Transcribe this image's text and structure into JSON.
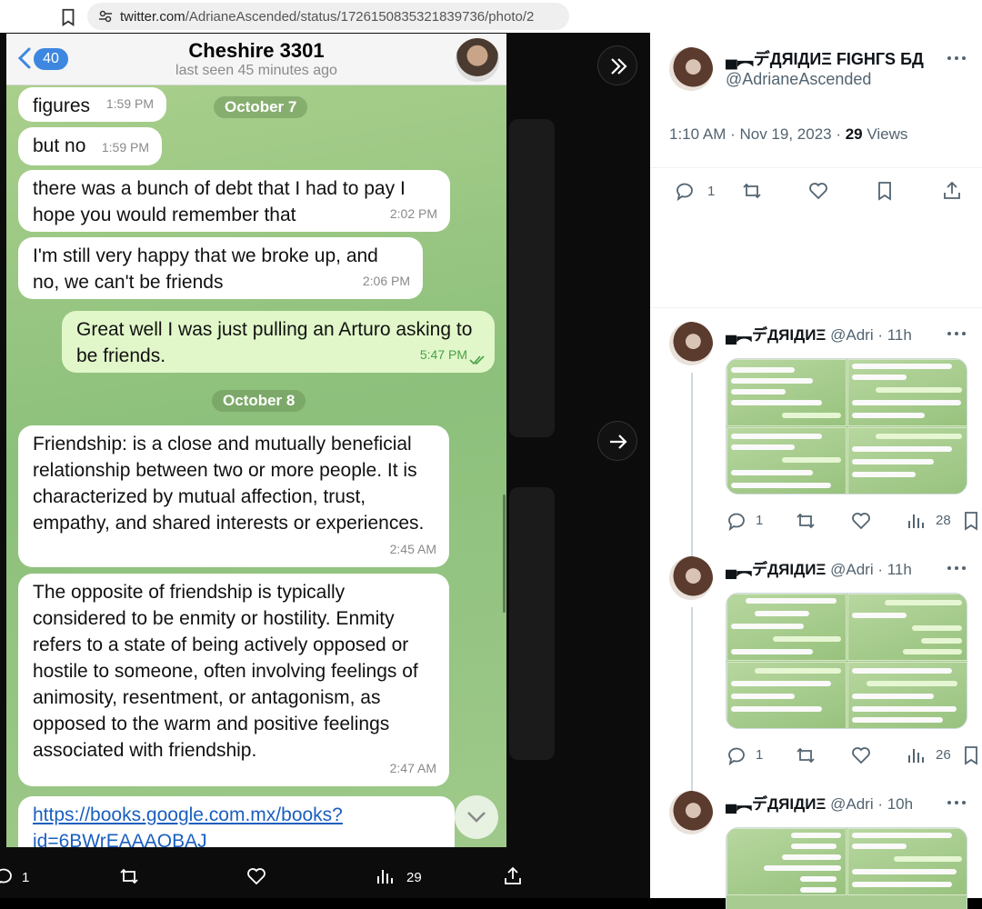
{
  "browser": {
    "url_domain": "twitter.com",
    "url_path": "/AdrianeAscended/status/1726150835321839736/photo/2"
  },
  "chat": {
    "back_count": "40",
    "contact_name": "Cheshire 3301",
    "last_seen": "last seen 45 minutes ago",
    "dates": [
      "October 7",
      "October 8"
    ],
    "messages": [
      {
        "text": "figures",
        "time": "1:59 PM",
        "dir": "in"
      },
      {
        "text": "but no",
        "time": "1:59 PM",
        "dir": "in"
      },
      {
        "text": "there was a bunch of debt that I had to pay I hope you would remember that",
        "time": "2:02 PM",
        "dir": "in"
      },
      {
        "text": "I'm still very happy that we broke up, and no, we can't be friends",
        "time": "2:06 PM",
        "dir": "in"
      },
      {
        "text": "Great well I was just pulling an Arturo asking to be friends.",
        "time": "5:47 PM",
        "dir": "out"
      },
      {
        "text": "Friendship: is a close and mutually beneficial relationship between two or more people. It is characterized by mutual affection, trust, empathy, and shared interests or experiences.",
        "time": "2:45 AM",
        "dir": "in"
      },
      {
        "text": "The opposite of friendship is typically considered to be enmity or hostility. Enmity refers to a state of being actively opposed or hostile to someone, often involving feelings of animosity, resentment, or antagonism, as opposed to the warm and positive feelings associated with friendship.",
        "time": "2:47 AM",
        "dir": "in"
      }
    ],
    "link_line1": "https://books.google.com.mx/books?",
    "link_line2": "id=6BWrEAAAQBAJ"
  },
  "bottom_bar": {
    "reply_count": "1",
    "views_count": "29"
  },
  "main_tweet": {
    "display_name": "▄︻デДЯIДИΞ FIGHГS БД",
    "handle": "@AdrianeAscended",
    "time": "1:10 AM · Nov 19, 2023 · ",
    "views_number": "29",
    "views_label": " Views",
    "reply_count": "1"
  },
  "replies": [
    {
      "display_name": "▄︻デДЯIДИΞ",
      "handle": "@Adri",
      "time": "· 11h",
      "reply_count": "1",
      "views": "28"
    },
    {
      "display_name": "▄︻デДЯIДИΞ",
      "handle": "@Adri",
      "time": "· 11h",
      "reply_count": "1",
      "views": "26"
    },
    {
      "display_name": "▄︻デДЯIДИΞ",
      "handle": "@Adri",
      "time": "· 10h"
    }
  ],
  "colors": {
    "telegram_blue": "#3d87e0",
    "chat_green": "#8cc07b",
    "outgoing_bubble": "#e1f7c9",
    "twitter_gray": "#536471"
  }
}
